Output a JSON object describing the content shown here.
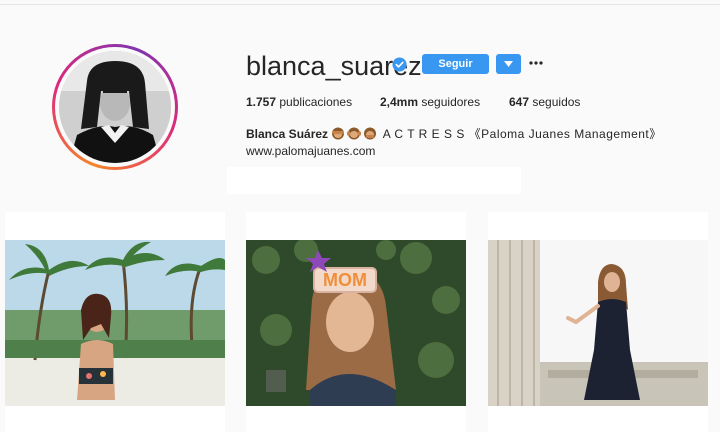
{
  "profile": {
    "username": "blanca_suarez",
    "verified": true,
    "follow_label": "Seguir",
    "stats": {
      "posts_count": "1.757",
      "posts_label": "publicaciones",
      "followers_count": "2,4mm",
      "followers_label": "seguidores",
      "following_count": "647",
      "following_label": "seguidos"
    },
    "full_name": "Blanca Suárez",
    "bio": "A C T R E S S 《Paloma Juanes Management》",
    "website": "www.palomajuanes.com"
  },
  "icons": {
    "verified": "verified-badge-icon",
    "dropdown": "chevron-down-icon",
    "more": "more-options-icon",
    "emoji": "monkey-emoji-icon"
  },
  "colors": {
    "accent": "#3897f0",
    "verified": "#3897f0",
    "background": "#fafafa"
  },
  "posts": [
    {
      "label": ""
    },
    {
      "label": "MOM"
    },
    {
      "label": ""
    }
  ]
}
